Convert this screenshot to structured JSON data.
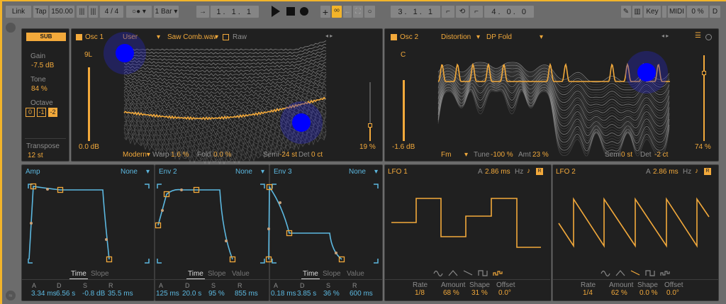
{
  "transport": {
    "link": "Link",
    "tap": "Tap",
    "tempo": "150.00",
    "sig": "4 / 4",
    "metro": "○●",
    "quant": "1 Bar",
    "position": "1.  1.  1",
    "loop_start": "3.  1.  1",
    "loop_len": "4.  0.  0",
    "key": "Key",
    "midi": "MIDI",
    "cpu": "0 %",
    "d": "D"
  },
  "sub": {
    "button": "SUB",
    "gain_label": "Gain",
    "gain": "-7.5 dB",
    "tone_label": "Tone",
    "tone": "84 %",
    "octave_label": "Octave",
    "octaves": [
      "0",
      "-1",
      "-2"
    ],
    "transpose_label": "Transpose",
    "transpose": "12 st"
  },
  "osc1": {
    "name": "Osc 1",
    "category": "User",
    "wavetable": "Saw Comb.wav",
    "raw": "Raw",
    "pan": "9L",
    "gain": "0.0 dB",
    "position": "19 %",
    "mode": "Modern",
    "warp_label": "Warp",
    "warp": "1.6 %",
    "fold_label": "Fold",
    "fold": "0.0 %",
    "semi_label": "Semi",
    "semi": "-24 st",
    "det_label": "Det",
    "det": "0 ct"
  },
  "osc2": {
    "name": "Osc 2",
    "category": "Distortion",
    "wavetable": "DP Fold",
    "pan": "C",
    "gain": "-1.6 dB",
    "position": "74 %",
    "mode": "Fm",
    "tune_label": "Tune",
    "tune": "-100 %",
    "amt_label": "Amt",
    "amt": "23 %",
    "semi_label": "Semi",
    "semi": "0 st",
    "det_label": "Det",
    "det": "-2 ct"
  },
  "envs": [
    {
      "name": "Amp",
      "mod": "None",
      "tabs": [
        "Time",
        "Slope"
      ],
      "labels": [
        "A",
        "D",
        "S",
        "R"
      ],
      "values": [
        "3.34 ms",
        "6.56 s",
        "-0.8 dB",
        "35.5 ms"
      ]
    },
    {
      "name": "Env 2",
      "mod": "None",
      "tabs": [
        "Time",
        "Slope",
        "Value"
      ],
      "labels": [
        "A",
        "D",
        "S",
        "R"
      ],
      "values": [
        "125 ms",
        "20.0 s",
        "95 %",
        "855 ms"
      ]
    },
    {
      "name": "Env 3",
      "mod": "None",
      "tabs": [
        "Time",
        "Slope",
        "Value"
      ],
      "labels": [
        "A",
        "D",
        "S",
        "R"
      ],
      "values": [
        "0.18 ms",
        "3.85 s",
        "36 %",
        "600 ms"
      ]
    }
  ],
  "lfos": [
    {
      "name": "LFO 1",
      "a_label": "A",
      "attack": "2.86 ms",
      "hz": "Hz",
      "labels": [
        "Rate",
        "Amount",
        "Shape",
        "Offset"
      ],
      "values": [
        "1/8",
        "68 %",
        "31 %",
        "0.0°"
      ],
      "selected_shape": "random"
    },
    {
      "name": "LFO 2",
      "a_label": "A",
      "attack": "2.86 ms",
      "hz": "Hz",
      "labels": [
        "Rate",
        "Amount",
        "Shape",
        "Offset"
      ],
      "values": [
        "1/4",
        "62 %",
        "0.0 %",
        "0.0°"
      ],
      "selected_shape": "saw"
    }
  ],
  "colors": {
    "accent": "#f2a93b",
    "env": "#5cb8e0",
    "panel": "#202020"
  }
}
